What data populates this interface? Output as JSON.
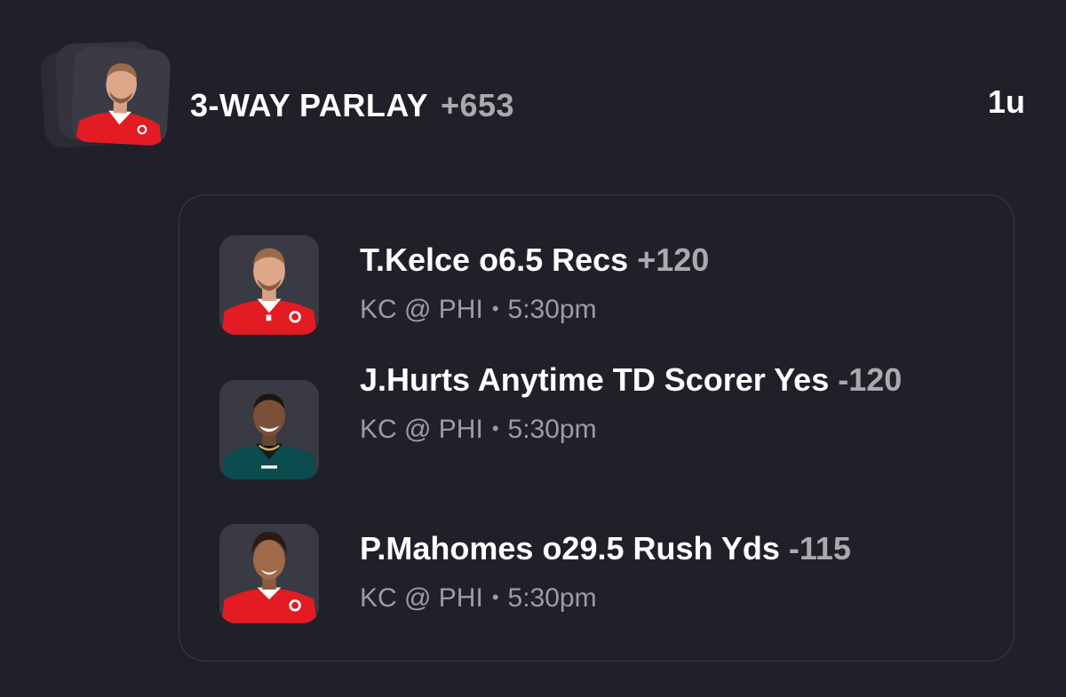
{
  "header": {
    "title": "3-WAY PARLAY",
    "odds": "+653",
    "units": "1u"
  },
  "legs": [
    {
      "player": "T.Kelce",
      "market": "o6.5 Recs",
      "odds": "+120",
      "game": "KC @ PHI",
      "separator": "•",
      "time": "5:30pm",
      "jersey_color": "#e31b23"
    },
    {
      "player": "J.Hurts",
      "market": "Anytime TD Scorer Yes",
      "odds": "-120",
      "game": "KC @ PHI",
      "separator": "•",
      "time": "5:30pm",
      "jersey_color": "#0b4c4e"
    },
    {
      "player": "P.Mahomes",
      "market": "o29.5 Rush Yds",
      "odds": "-115",
      "game": "KC @ PHI",
      "separator": "•",
      "time": "5:30pm",
      "jersey_color": "#e31b23"
    }
  ],
  "colors": {
    "background": "#202029",
    "odds_gray": "#a9a9b0",
    "meta_gray": "#9c9ca4",
    "border": "#3a3b44"
  }
}
